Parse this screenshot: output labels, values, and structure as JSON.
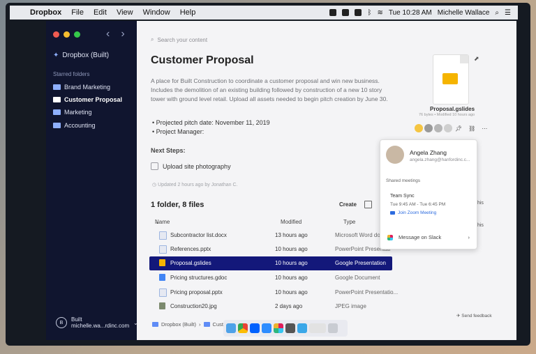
{
  "menubar": {
    "app": "Dropbox",
    "items": [
      "File",
      "Edit",
      "View",
      "Window",
      "Help"
    ],
    "clock": "Tue 10:28 AM",
    "user": "Michelle Wallace"
  },
  "sidebar": {
    "brand": "Dropbox (Built)",
    "starred_title": "Starred folders",
    "folders": [
      "Brand Marketing",
      "Customer Proposal",
      "Marketing",
      "Accounting"
    ],
    "account_name": "Built",
    "account_email": "michelle.wa...rdinc.com"
  },
  "main": {
    "search_placeholder": "Search your content",
    "title": "Customer Proposal",
    "description": "A place for Built Construction to coordinate a customer proposal and win new business. Includes the demolition of an existing building followed by construction of a new 10 story tower with ground level retail. Upload all assets needed to begin pitch creation by June 30.",
    "bullets": [
      "Projected pitch date: November 11, 2019",
      "Project Manager:"
    ],
    "next_steps": "Next Steps:",
    "task": "Upload site photography",
    "updated": "Updated 2 hours ago by Jonathan C.",
    "count": "1 folder, 8 files",
    "create": "Create",
    "headers": {
      "name": "Name",
      "modified": "Modified",
      "type": "Type"
    },
    "rows": [
      {
        "name": "Subcontractor list.docx",
        "modified": "13 hours ago",
        "type": "Microsoft Word docu"
      },
      {
        "name": "References.pptx",
        "modified": "10 hours ago",
        "type": "PowerPoint Presentati"
      },
      {
        "name": "Proposal.gslides",
        "modified": "10 hours ago",
        "type": "Google Presentation"
      },
      {
        "name": "Pricing structures.gdoc",
        "modified": "10 hours ago",
        "type": "Google Document"
      },
      {
        "name": "Pricing proposal.pptx",
        "modified": "10 hours ago",
        "type": "PowerPoint Presentatio..."
      },
      {
        "name": "Construction20.jpg",
        "modified": "2 days ago",
        "type": "JPEG image"
      }
    ],
    "breadcrumb": [
      "Dropbox (Built)",
      "Cust"
    ],
    "feedback": "Send feedback",
    "this1": "this",
    "this2": "this"
  },
  "preview": {
    "file_name": "Proposal.gslides",
    "meta": "76 bytes • Modified 10 hours ago"
  },
  "popover": {
    "name": "Angela Zhang",
    "email": "angela.zhang@hanfordinc.c...",
    "shared": "Shared meetings",
    "meeting_title": "Team Sync",
    "meeting_time": "Tue 9:45 AM - Tue 6:45 PM",
    "zoom": "Join Zoom Meeting",
    "slack": "Message on Slack"
  },
  "colors": {
    "sidebar_bg": "#10152f",
    "selected_row": "#13187a",
    "gslides": "#f5b400"
  }
}
